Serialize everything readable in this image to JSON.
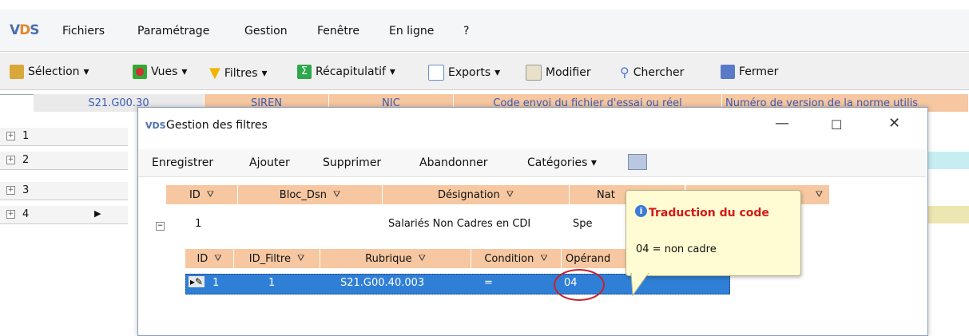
{
  "app": {
    "logo": "VDS",
    "bg_accent": "#f6c7a0"
  },
  "menu": {
    "items": [
      "Fichiers",
      "Paramétrage",
      "Gestion",
      "Fenêtre",
      "En ligne",
      "?"
    ]
  },
  "toolbar": {
    "items": [
      {
        "label": "Sélection",
        "dropdown": true,
        "icon": "selection-icon"
      },
      {
        "label": "Vues",
        "dropdown": true,
        "icon": "views-icon"
      },
      {
        "label": "Filtres",
        "dropdown": true,
        "icon": "filter-icon"
      },
      {
        "label": "Récapitulatif",
        "dropdown": true,
        "icon": "sum-icon"
      },
      {
        "label": "Exports",
        "dropdown": true,
        "icon": "export-icon"
      },
      {
        "label": "Modifier",
        "dropdown": false,
        "icon": "edit-icon"
      },
      {
        "label": "Chercher",
        "dropdown": false,
        "icon": "search-icon"
      },
      {
        "label": "Fermer",
        "dropdown": false,
        "icon": "close-door-icon"
      }
    ]
  },
  "main_grid": {
    "columns": [
      "S21.G00.30",
      "SIREN",
      "NIC",
      "Code envoi du fichier d'essai ou réel",
      "Numéro de version de la norme utilis"
    ],
    "rows": [
      "1",
      "2",
      "3",
      "4"
    ],
    "row_colors": [
      "#ffffff",
      "#c6eef2",
      "#ffffff",
      "#ece6b0"
    ]
  },
  "dialog": {
    "title": "Gestion des filtres",
    "logo": "VDS",
    "toolbar": [
      "Enregistrer",
      "Ajouter",
      "Supprimer",
      "Abandonner",
      "Catégories"
    ],
    "outer_grid": {
      "columns": [
        "ID",
        "Bloc_Dsn",
        "Désignation",
        "Nat"
      ],
      "row": {
        "id": "1",
        "bloc": "",
        "designation": "Salariés Non Cadres en CDI",
        "nat": "Spe"
      }
    },
    "inner_grid": {
      "columns": [
        "ID",
        "ID_Filtre",
        "Rubrique",
        "Condition",
        "Opérand"
      ],
      "row": {
        "id": "1",
        "id_filtre": "1",
        "rubrique": "S21.G00.40.003",
        "condition": "=",
        "operande": "04"
      }
    }
  },
  "tooltip": {
    "title": "Traduction du code",
    "body": "04 = non cadre"
  }
}
